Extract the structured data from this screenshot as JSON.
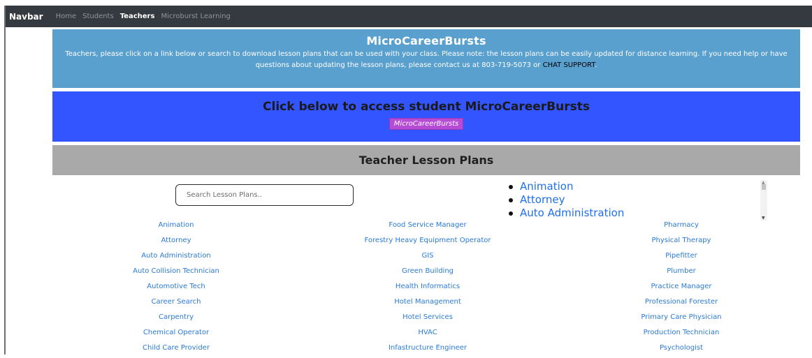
{
  "navbar": {
    "brand": "Navbar",
    "links": [
      "Home",
      "Students",
      "Teachers",
      "Microburst Learning"
    ]
  },
  "info": {
    "title": "MicroCareerBursts",
    "text": "Teachers, please click on a link below or search to download lesson plans that can be used with your class. Please note: the lesson plans can be easily updated for distance learning. If you need help or have questions about updating the lesson plans, please contact us at 803-719-5073 or",
    "chat_link": "CHAT SUPPORT",
    "period": "."
  },
  "student": {
    "title": "Click below to access student MicroCareerBursts",
    "button_label": "MicroCareerBursts"
  },
  "plans": {
    "title": "Teacher Lesson Plans",
    "search_placeholder": "Search Lesson Plans..",
    "dropdown_items": [
      "Animation",
      "Attorney",
      "Auto Administration"
    ]
  },
  "columns": [
    [
      "Animation",
      "Attorney",
      "Auto Administration",
      "Auto Collision Technician",
      "Automotive Tech",
      "Career Search",
      "Carpentry",
      "Chemical Operator",
      "Child Care Provider"
    ],
    [
      "Food Service Manager",
      "Forestry Heavy Equipment Operator",
      "GIS",
      "Green Building",
      "Health Informatics",
      "Hotel Management",
      "Hotel Services",
      "HVAC",
      "Infastructure Engineer"
    ],
    [
      "Pharmacy",
      "Physical Therapy",
      "Pipefitter",
      "Plumber",
      "Practice Manager",
      "Professional Forester",
      "Primary Care Physician",
      "Production Technician",
      "Psychologist"
    ]
  ],
  "colors": {
    "navbar": "#343a40",
    "info_panel": "#5aa0cf",
    "student_panel": "#3355ff",
    "student_button": "#b64bd6",
    "plans_bar": "#a9a9a9",
    "link": "#2a7ad5"
  }
}
